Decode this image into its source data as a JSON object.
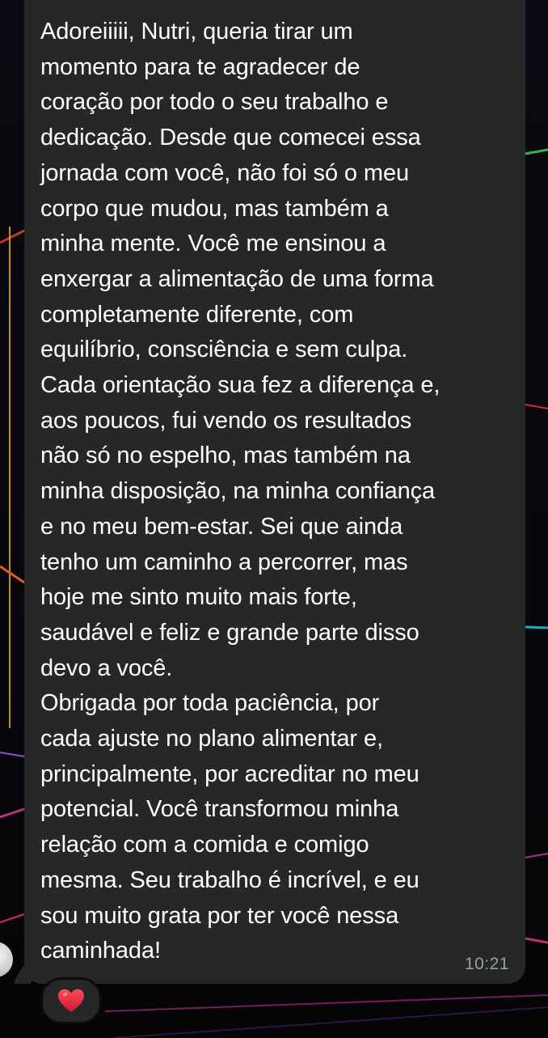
{
  "message": {
    "text": "Adoreiiiii, Nutri, queria  tirar um\nmomento para te agradecer de\ncoração por todo o seu trabalho e\ndedicação. Desde que comecei essa\njornada com você, não foi só o meu\ncorpo que mudou, mas também a\nminha mente. Você me ensinou a\nenxergar a alimentação de uma forma\ncompletamente diferente, com\nequilíbrio, consciência e sem culpa.\nCada orientação sua fez a diferença e,\naos poucos, fui vendo os resultados\nnão só no espelho, mas também na\nminha disposição, na minha confiança\ne no meu bem-estar. Sei que ainda\ntenho um caminho a percorrer, mas\nhoje me sinto muito mais forte,\nsaudável e feliz e grande parte disso\ndevo a você.\nObrigada por toda paciência, por\ncada ajuste no plano alimentar e,\nprincipalmente, por acreditar no meu\npotencial. Você transformou minha\nrelação com a comida e comigo\nmesma. Seu trabalho é incrível, e eu\nsou muito grata por ter você nessa\ncaminhada!",
    "time": "10:21"
  },
  "reaction": {
    "icon": "heart-icon",
    "color": "#e8283c"
  },
  "colors": {
    "bubble": "#262828",
    "text": "#ffffff",
    "timestamp": "#9aa0a0"
  }
}
